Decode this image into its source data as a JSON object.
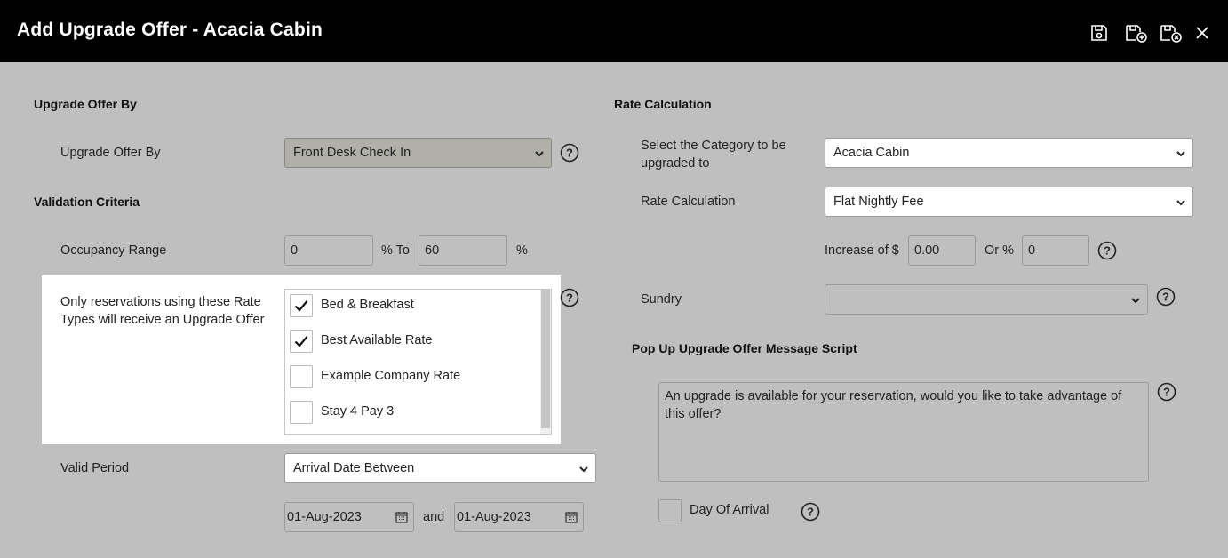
{
  "window": {
    "title": "Add Upgrade Offer - Acacia Cabin"
  },
  "toolbar": {
    "icons": [
      "save-icon",
      "save-and-new-icon",
      "save-and-close-icon",
      "close-icon"
    ]
  },
  "left": {
    "section_offer": "Upgrade Offer By",
    "offer_by_label": "Upgrade Offer By",
    "offer_by_value": "Front Desk Check In",
    "section_validation": "Validation Criteria",
    "occupancy_label": "Occupancy Range",
    "occupancy_from": "0",
    "occupancy_to_label": "% To",
    "occupancy_to": "60",
    "occupancy_unit": "%",
    "rate_types_label": "Only reservations using these Rate Types will receive an Upgrade Offer",
    "rate_types": [
      {
        "label": "Bed & Breakfast",
        "checked": true
      },
      {
        "label": "Best Available Rate",
        "checked": true
      },
      {
        "label": "Example Company Rate",
        "checked": false
      },
      {
        "label": "Stay 4 Pay 3",
        "checked": false
      }
    ],
    "valid_period_label": "Valid Period",
    "valid_period_value": "Arrival Date Between",
    "date_from": "01-Aug-2023",
    "date_and": "and",
    "date_to": "01-Aug-2023"
  },
  "right": {
    "section_rate": "Rate Calculation",
    "category_label": "Select the Category to be upgraded to",
    "category_value": "Acacia Cabin",
    "rate_calc_label": "Rate Calculation",
    "rate_calc_value": "Flat Nightly Fee",
    "increase_label": "Increase of $",
    "increase_value": "0.00",
    "or_pct_label": "Or %",
    "or_pct_value": "0",
    "sundry_label": "Sundry",
    "sundry_value": "",
    "section_popup": "Pop Up Upgrade Offer Message Script",
    "popup_message": "An upgrade is available for your reservation, would you like to take advantage of this offer?",
    "day_of_arrival_label": "Day Of Arrival",
    "day_of_arrival_checked": false
  },
  "colors": {
    "titlebar": "#000000",
    "background": "#bfbfbf",
    "highlight": "#ffffff"
  }
}
